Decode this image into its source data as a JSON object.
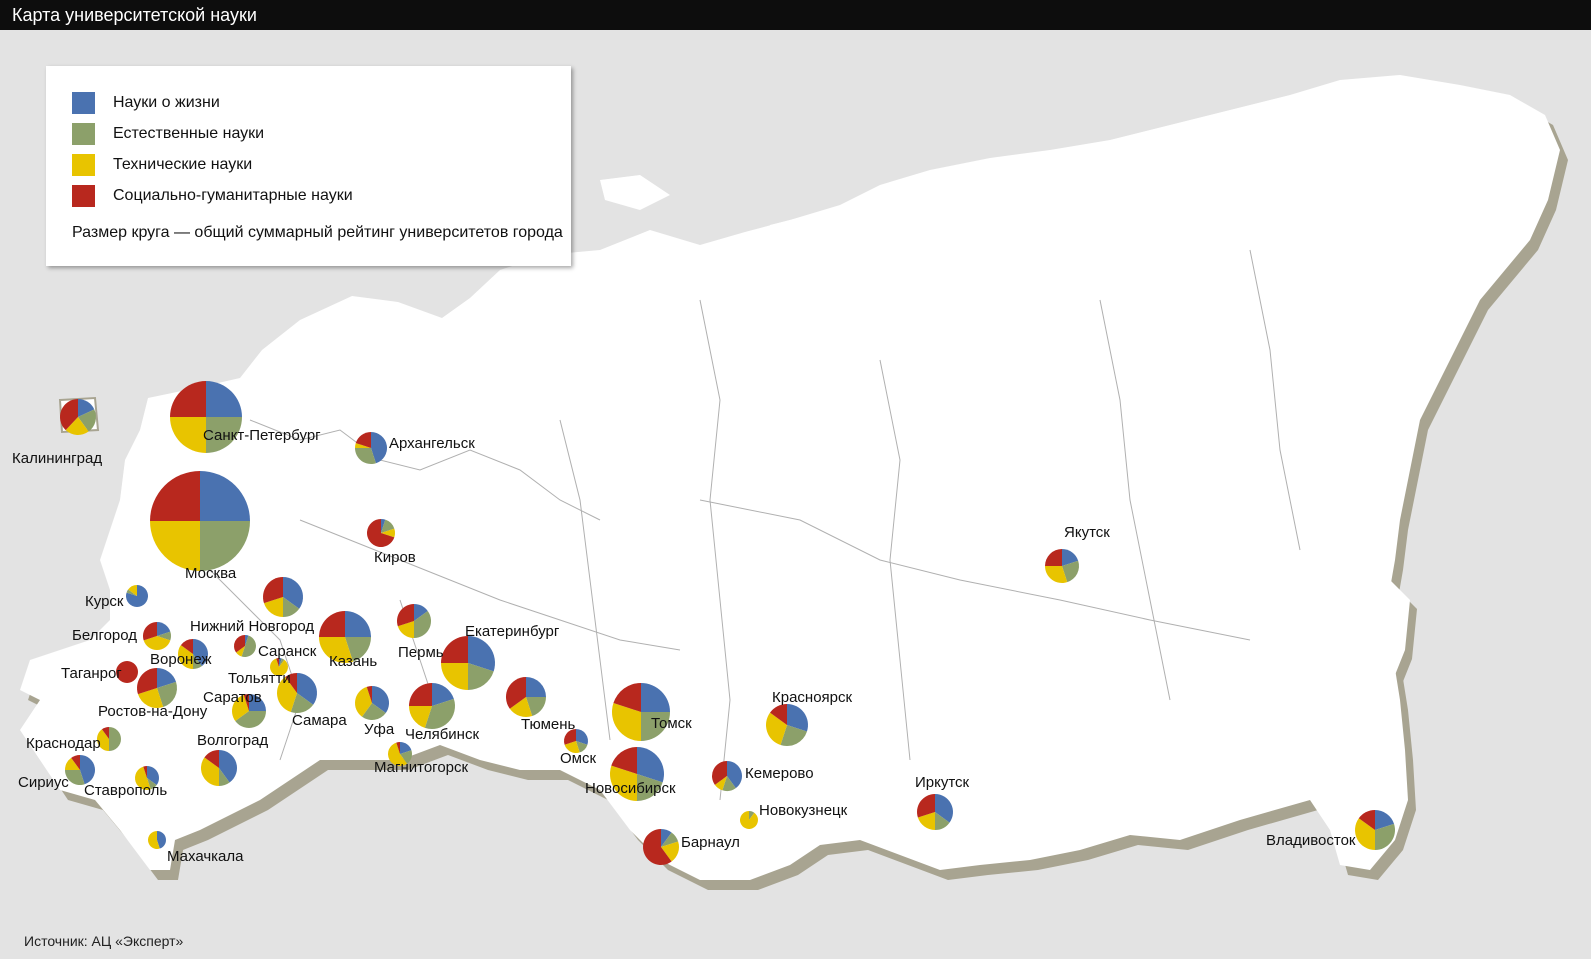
{
  "title": "Карта университетской науки",
  "legend": {
    "items": [
      {
        "label": "Науки о жизни",
        "color": "#4a72b0"
      },
      {
        "label": "Естественные науки",
        "color": "#8ca06a"
      },
      {
        "label": "Технические науки",
        "color": "#e8c400"
      },
      {
        "label": "Социально-гуманитарные науки",
        "color": "#b8281e"
      }
    ],
    "size_note": "Размер круга — общий суммарный рейтинг университетов города"
  },
  "source": "Источник: АЦ «Эксперт»",
  "colors": {
    "background": "#e3e3e3",
    "land": "#ffffff",
    "land_shadow": "#a8a491",
    "border": "#b0b0b0",
    "title_bar": "#0d0d0d",
    "life": "#4a72b0",
    "natural": "#8ca06a",
    "technical": "#e8c400",
    "social": "#b8281e"
  },
  "cities": [
    {
      "name": "Калининград"
    },
    {
      "name": "Санкт-Петербург"
    },
    {
      "name": "Архангельск"
    },
    {
      "name": "Москва"
    },
    {
      "name": "Киров"
    },
    {
      "name": "Курск"
    },
    {
      "name": "Нижний Новгород"
    },
    {
      "name": "Белгород"
    },
    {
      "name": "Саранск"
    },
    {
      "name": "Воронеж"
    },
    {
      "name": "Таганрог"
    },
    {
      "name": "Тольятти"
    },
    {
      "name": "Казань"
    },
    {
      "name": "Пермь"
    },
    {
      "name": "Екатеринбург"
    },
    {
      "name": "Саратов"
    },
    {
      "name": "Ростов-на-Дону"
    },
    {
      "name": "Самара"
    },
    {
      "name": "Уфа"
    },
    {
      "name": "Челябинск"
    },
    {
      "name": "Тюмень"
    },
    {
      "name": "Томск"
    },
    {
      "name": "Краснодар"
    },
    {
      "name": "Волгоград"
    },
    {
      "name": "Магнитогорск"
    },
    {
      "name": "Омск"
    },
    {
      "name": "Сириус"
    },
    {
      "name": "Ставрополь"
    },
    {
      "name": "Новосибирск"
    },
    {
      "name": "Кемерово"
    },
    {
      "name": "Красноярск"
    },
    {
      "name": "Новокузнецк"
    },
    {
      "name": "Барнаул"
    },
    {
      "name": "Махачкала"
    },
    {
      "name": "Якутск"
    },
    {
      "name": "Иркутск"
    },
    {
      "name": "Владивосток"
    }
  ]
}
